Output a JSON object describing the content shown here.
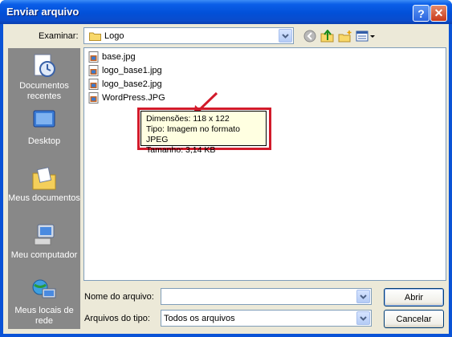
{
  "window": {
    "title": "Enviar arquivo",
    "help_label": "?",
    "close_label": "✕"
  },
  "toolbar": {
    "lookin_label": "Examinar:",
    "lookin_value": "Logo",
    "icons": [
      "back-icon",
      "up-folder-icon",
      "new-folder-icon",
      "view-menu-icon"
    ]
  },
  "places": [
    {
      "label": "Documentos recentes",
      "icon": "recent-documents-icon"
    },
    {
      "label": "Desktop",
      "icon": "desktop-icon"
    },
    {
      "label": "Meus documentos",
      "icon": "my-documents-icon"
    },
    {
      "label": "Meu computador",
      "icon": "my-computer-icon"
    },
    {
      "label": "Meus locais de rede",
      "icon": "network-places-icon"
    }
  ],
  "files": [
    {
      "name": "base.jpg"
    },
    {
      "name": "logo_base1.jpg"
    },
    {
      "name": "logo_base2.jpg"
    },
    {
      "name": "WordPress.JPG"
    }
  ],
  "tooltip": {
    "dimensions": "Dimensões: 118 x 122",
    "type": "Tipo: Imagem no formato JPEG",
    "size": "Tamanho: 3,14 KB"
  },
  "annotation": {
    "color": "#d21a2a"
  },
  "form": {
    "filename_label": "Nome do arquivo:",
    "filename_value": "",
    "filetype_label": "Arquivos do tipo:",
    "filetype_value": "Todos os arquivos"
  },
  "buttons": {
    "open": "Abrir",
    "cancel": "Cancelar"
  }
}
